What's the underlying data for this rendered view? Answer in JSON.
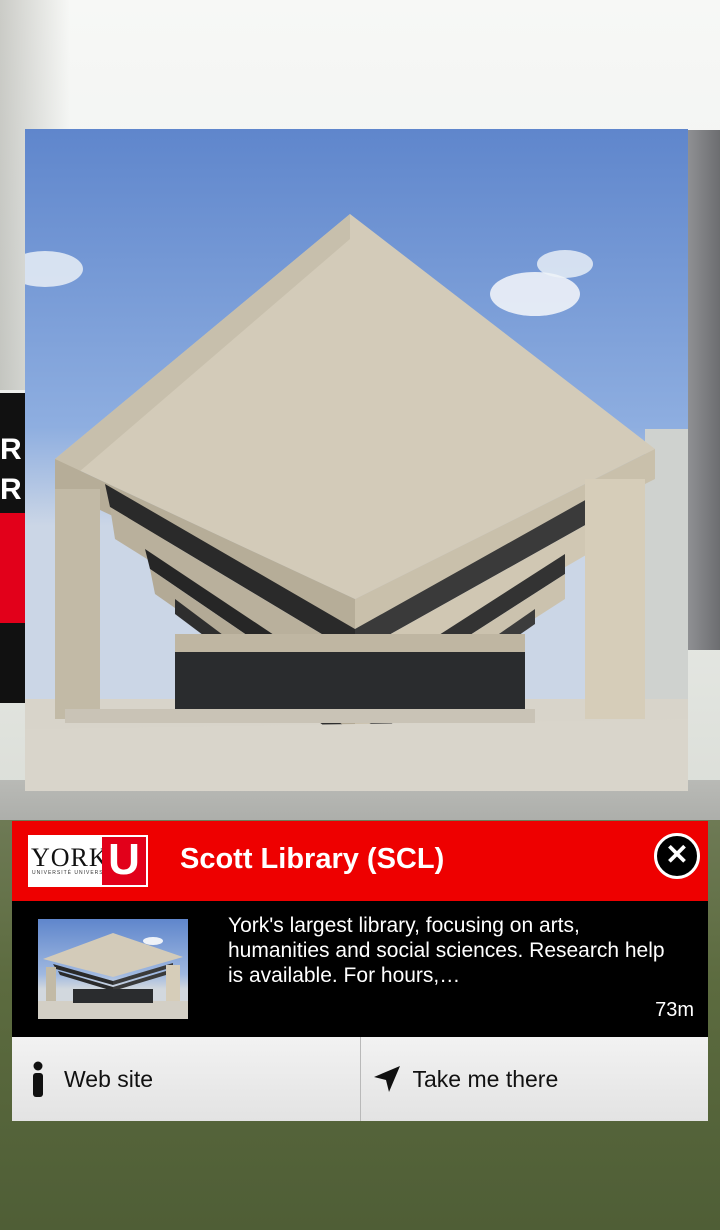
{
  "poi": {
    "title": "Scott Library (SCL)",
    "description": "York's largest library, focusing on arts, humanities and social sciences. Research help is available. For hours,…",
    "distance": "73m"
  },
  "logo": {
    "york": "YORK",
    "u": "U",
    "sub": "UNIVERSITÉ UNIVERSITY"
  },
  "background_sign": {
    "line1": "R",
    "line2": "R"
  },
  "actions": {
    "website_label": "Web site",
    "navigate_label": "Take me there"
  },
  "icons": {
    "close": "close-icon",
    "info": "info-icon",
    "navigate": "navigation-arrow-icon"
  },
  "colors": {
    "header_red": "#ee0000",
    "body_black": "#000000",
    "button_bg": "#eaeaea"
  }
}
